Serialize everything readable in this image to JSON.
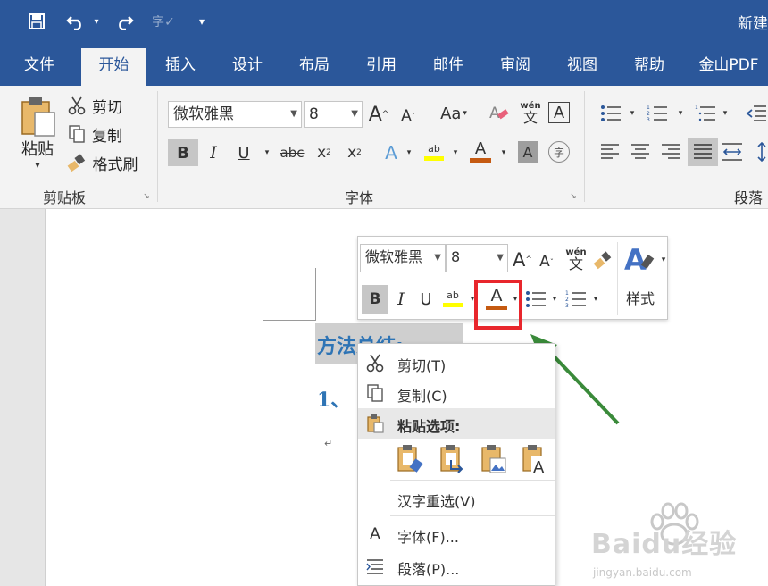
{
  "titlebar": {
    "doc_title": "新建",
    "quick_access": [
      "save-icon",
      "undo-icon",
      "redo-icon",
      "spelling-icon",
      "customize-icon"
    ]
  },
  "tabs": [
    {
      "label": "文件"
    },
    {
      "label": "开始"
    },
    {
      "label": "插入"
    },
    {
      "label": "设计"
    },
    {
      "label": "布局"
    },
    {
      "label": "引用"
    },
    {
      "label": "邮件"
    },
    {
      "label": "审阅"
    },
    {
      "label": "视图"
    },
    {
      "label": "帮助"
    },
    {
      "label": "金山PDF"
    }
  ],
  "ribbon": {
    "clipboard": {
      "paste": "粘贴",
      "cut": "剪切",
      "copy": "复制",
      "format_painter": "格式刷",
      "group_label": "剪贴板"
    },
    "font": {
      "font_name": "微软雅黑",
      "font_size": "8",
      "change_case": "Aa",
      "phonetic": "wén",
      "phonetic_char": "文",
      "group_label": "字体",
      "font_color": "#c55a11",
      "highlight_color": "#ffff00",
      "shading_color": "#9e9e9e"
    },
    "paragraph": {
      "group_label": "段落"
    }
  },
  "document": {
    "heading": "方法总结:",
    "item_partial": "1、",
    "paragraph_mark": "↵",
    "heading_color": "#2e74b5"
  },
  "minibar": {
    "font_name": "微软雅黑",
    "font_size": "8",
    "phonetic": "wén",
    "phonetic_char": "文",
    "styles": "样式",
    "font_color": "#c55a11",
    "highlight_color": "#ffff00"
  },
  "context_menu": {
    "items": [
      {
        "label": "剪切(T)",
        "icon": "scissors-icon"
      },
      {
        "label": "复制(C)",
        "icon": "copy-icon"
      },
      {
        "label": "粘贴选项:",
        "icon": "paste-icon"
      },
      {
        "label": "汉字重选(V)"
      },
      {
        "label": "字体(F)...",
        "icon": "font-icon"
      },
      {
        "label": "段落(P)...",
        "icon": "paragraph-icon"
      }
    ]
  },
  "annotation": {
    "highlight_color": "#e8262c",
    "arrow_color": "#3a8a3a"
  },
  "watermark": {
    "brand": "Baidu经验",
    "url": "jingyan.baidu.com"
  }
}
